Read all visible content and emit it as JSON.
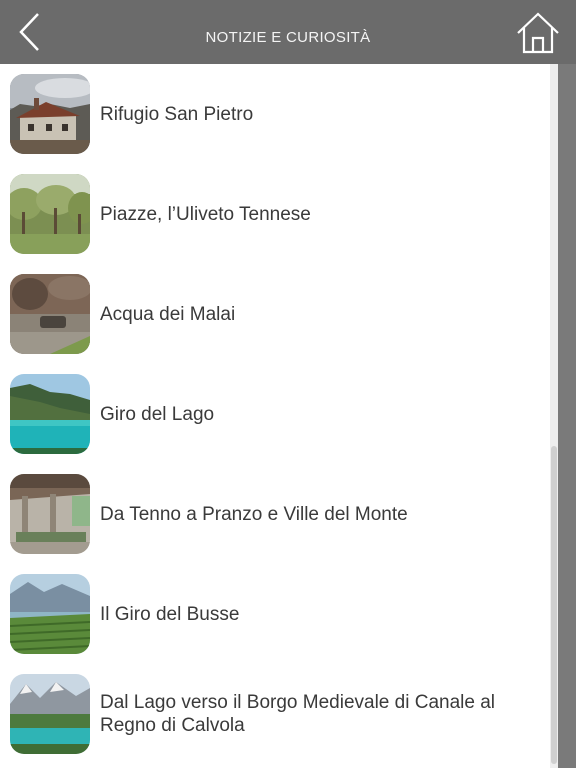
{
  "header": {
    "title": "NOTIZIE E CURIOSITÀ",
    "back_icon": "chevron-left-icon",
    "home_icon": "home-outline-icon",
    "background_color": "#6b6b6b"
  },
  "items": [
    {
      "label": "Rifugio San Pietro",
      "thumbnail": "stone-house-photo"
    },
    {
      "label": "Piazze, l’Uliveto Tennese",
      "thumbnail": "olive-grove-photo"
    },
    {
      "label": "Acqua dei Malai",
      "thumbnail": "stone-fountain-photo"
    },
    {
      "label": "Giro del Lago",
      "thumbnail": "turquoise-lake-photo"
    },
    {
      "label": "Da Tenno a Pranzo e Ville del Monte",
      "thumbnail": "wash-house-photo"
    },
    {
      "label": "Il Giro del Busse",
      "thumbnail": "vineyard-valley-photo"
    },
    {
      "label": "Dal Lago verso il Borgo Medievale di Canale al Regno di Calvola",
      "thumbnail": "mountain-lake-photo"
    }
  ]
}
